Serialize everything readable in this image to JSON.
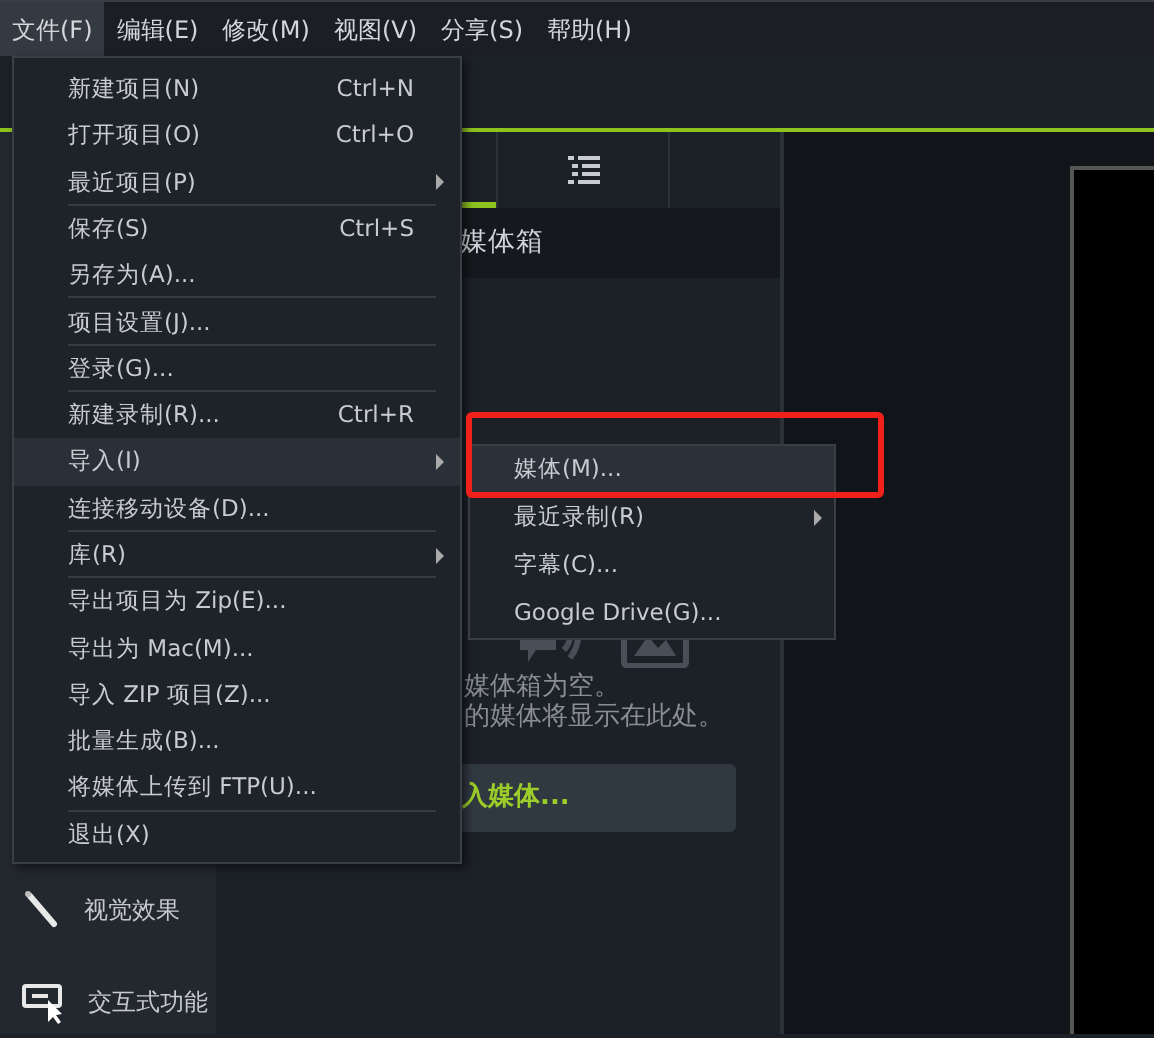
{
  "menubar": [
    {
      "label": "文件(F)",
      "selected": true
    },
    {
      "label": "编辑(E)",
      "selected": false
    },
    {
      "label": "修改(M)",
      "selected": false
    },
    {
      "label": "视图(V)",
      "selected": false
    },
    {
      "label": "分享(S)",
      "selected": false
    },
    {
      "label": "帮助(H)",
      "selected": false
    }
  ],
  "file_menu": {
    "items": [
      {
        "label": "新建项目(N)",
        "shortcut": "Ctrl+N",
        "has_submenu": false,
        "separator_after": false,
        "selected": false
      },
      {
        "label": "打开项目(O)",
        "shortcut": "Ctrl+O",
        "has_submenu": false,
        "separator_after": false,
        "selected": false
      },
      {
        "label": "最近项目(P)",
        "has_submenu": true,
        "separator_after": true,
        "selected": false
      },
      {
        "label": "保存(S)",
        "shortcut": "Ctrl+S",
        "has_submenu": false,
        "separator_after": false,
        "selected": false
      },
      {
        "label": "另存为(A)...",
        "has_submenu": false,
        "separator_after": true,
        "selected": false
      },
      {
        "label": "项目设置(J)...",
        "has_submenu": false,
        "separator_after": true,
        "selected": false
      },
      {
        "label": "登录(G)...",
        "has_submenu": false,
        "separator_after": true,
        "selected": false
      },
      {
        "label": "新建录制(R)...",
        "shortcut": "Ctrl+R",
        "has_submenu": false,
        "separator_after": false,
        "selected": false
      },
      {
        "label": "导入(I)",
        "has_submenu": true,
        "separator_after": false,
        "selected": true
      },
      {
        "label": "连接移动设备(D)...",
        "has_submenu": false,
        "separator_after": true,
        "selected": false
      },
      {
        "label": "库(R)",
        "has_submenu": true,
        "separator_after": true,
        "selected": false
      },
      {
        "label": "导出项目为 Zip(E)...",
        "has_submenu": false,
        "separator_after": false,
        "selected": false
      },
      {
        "label": "导出为 Mac(M)...",
        "has_submenu": false,
        "separator_after": false,
        "selected": false
      },
      {
        "label": "导入 ZIP 项目(Z)...",
        "has_submenu": false,
        "separator_after": false,
        "selected": false
      },
      {
        "label": "批量生成(B)...",
        "has_submenu": false,
        "separator_after": false,
        "selected": false
      },
      {
        "label": "将媒体上传到 FTP(U)...",
        "has_submenu": false,
        "separator_after": true,
        "selected": false
      },
      {
        "label": "退出(X)",
        "has_submenu": false,
        "separator_after": false,
        "selected": false
      }
    ]
  },
  "import_submenu": {
    "items": [
      {
        "label": "媒体(M)...",
        "has_submenu": false,
        "selected": true
      },
      {
        "label": "最近录制(R)",
        "has_submenu": true,
        "selected": false
      },
      {
        "label": "字幕(C)...",
        "has_submenu": false,
        "selected": false
      },
      {
        "label": "Google Drive(G)...",
        "has_submenu": false,
        "selected": false
      }
    ]
  },
  "media_bin": {
    "title": "媒体箱",
    "empty_lines": [
      "媒体箱为空。",
      "的媒体将显示在此处。"
    ],
    "import_button": "入媒体..."
  },
  "sidebar": {
    "items": [
      {
        "kind": "wand",
        "label": "视觉效果"
      },
      {
        "kind": "interactive",
        "label": "交互式功能"
      }
    ]
  }
}
